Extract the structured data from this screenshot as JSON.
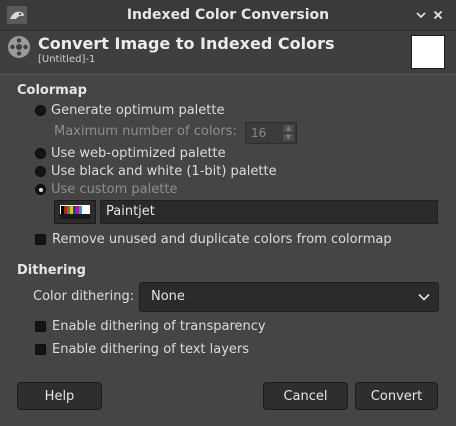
{
  "window": {
    "title": "Indexed Color Conversion"
  },
  "header": {
    "title": "Convert Image to Indexed Colors",
    "subtitle": "[Untitled]-1"
  },
  "colormap": {
    "section_title": "Colormap",
    "generate_label": "Generate optimum palette",
    "max_colors_label": "Maximum number of colors:",
    "max_colors_value": "16",
    "web_label": "Use web-optimized palette",
    "bw_label": "Use black and white (1-bit) palette",
    "custom_label": "Use custom palette",
    "selected_option": "Use custom palette",
    "palette_name": "Paintjet",
    "remove_unused_label": "Remove unused and duplicate colors from colormap",
    "remove_unused_checked": false
  },
  "dithering": {
    "section_title": "Dithering",
    "color_dithering_label": "Color dithering:",
    "color_dithering_value": "None",
    "transparency_label": "Enable dithering of transparency",
    "transparency_checked": false,
    "text_layers_label": "Enable dithering of text layers",
    "text_layers_checked": false
  },
  "buttons": {
    "help": "Help",
    "cancel": "Cancel",
    "convert": "Convert"
  },
  "icons": {
    "app": "gimp-wilber-icon",
    "header": "film-reel-icon",
    "palette_swatch": "palette-swatch-icon",
    "combo_arrow": "chevron-down-icon",
    "window_menu": "chevron-down-icon",
    "window_close": "close-icon"
  },
  "colors": {
    "background": "#454545",
    "titlebar": "#3a3a3a",
    "field": "#2a2a2a",
    "text": "#dcdcdc"
  }
}
